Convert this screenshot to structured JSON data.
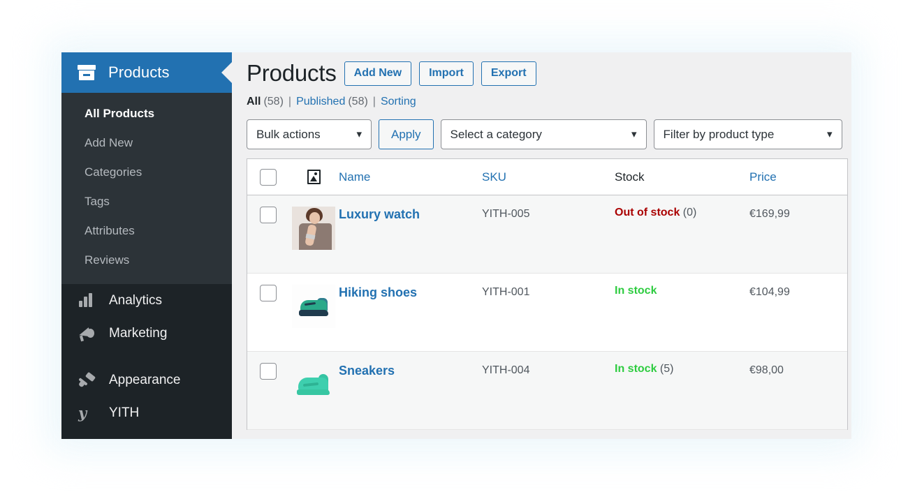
{
  "sidebar": {
    "current_menu": {
      "label": "Products",
      "icon": "box-icon"
    },
    "submenu": [
      {
        "label": "All Products",
        "active": true
      },
      {
        "label": "Add New",
        "active": false
      },
      {
        "label": "Categories",
        "active": false
      },
      {
        "label": "Tags",
        "active": false
      },
      {
        "label": "Attributes",
        "active": false
      },
      {
        "label": "Reviews",
        "active": false
      }
    ],
    "menu": [
      {
        "label": "Analytics",
        "icon": "bar-chart-icon"
      },
      {
        "label": "Marketing",
        "icon": "megaphone-icon"
      },
      {
        "label": "Appearance",
        "icon": "paintbrush-icon"
      },
      {
        "label": "YITH",
        "icon": "yith-logo-icon"
      }
    ]
  },
  "header": {
    "title": "Products",
    "buttons": [
      {
        "label": "Add New"
      },
      {
        "label": "Import"
      },
      {
        "label": "Export"
      }
    ]
  },
  "views": {
    "all_label": "All",
    "all_count": "(58)",
    "published_label": "Published",
    "published_count": "(58)",
    "sorting_label": "Sorting",
    "separator": "|"
  },
  "tablenav": {
    "bulk_actions": {
      "value": "Bulk actions",
      "chevron": "chevron-down-icon"
    },
    "apply_label": "Apply",
    "category": {
      "value": "Select a category",
      "chevron": "chevron-down-icon"
    },
    "product_type": {
      "value": "Filter by product type",
      "chevron": "chevron-down-icon"
    }
  },
  "table": {
    "columns": {
      "image": "image-column-icon",
      "name": "Name",
      "sku": "SKU",
      "stock": "Stock",
      "price": "Price"
    },
    "rows": [
      {
        "name": "Luxury watch",
        "sku": "YITH-005",
        "stock_status": "Out of stock",
        "stock_qty": "(0)",
        "stock_state": "out",
        "price": "€169,99",
        "thumb": "woman-wearing-watch-photo"
      },
      {
        "name": "Hiking shoes",
        "sku": "YITH-001",
        "stock_status": "In stock",
        "stock_qty": "",
        "stock_state": "in",
        "price": "€104,99",
        "thumb": "teal-hiking-shoe-photo"
      },
      {
        "name": "Sneakers",
        "sku": "YITH-004",
        "stock_status": "In stock",
        "stock_qty": "(5)",
        "stock_state": "in",
        "price": "€98,00",
        "thumb": "green-sneaker-photo"
      }
    ]
  },
  "colors": {
    "admin_blue": "#2271b1",
    "sidebar_dark": "#1d2327",
    "submenu_dark": "#2c3338",
    "in_stock_green": "#2ecc40",
    "out_of_stock_red": "#aa0000",
    "content_bg": "#f0f0f1"
  }
}
